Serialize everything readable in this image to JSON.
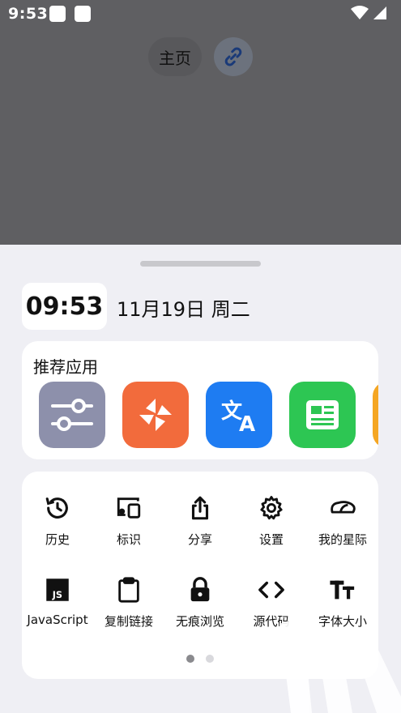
{
  "status_bar": {
    "time": "9:53"
  },
  "top": {
    "home_label": "主页",
    "link_icon": "link-icon"
  },
  "clock": {
    "time": "09:53",
    "date": "11月19日 周二"
  },
  "recommended": {
    "title": "推荐应用",
    "apps": [
      {
        "name": "sliders-app",
        "color": "#8d90ab"
      },
      {
        "name": "pinwheel-app",
        "color": "#f26b3c"
      },
      {
        "name": "translate-app",
        "color": "#1e7cf2"
      },
      {
        "name": "news-app",
        "color": "#2dc653"
      },
      {
        "name": "partial-app",
        "color": "#f5a623"
      }
    ]
  },
  "tools": {
    "row1": [
      "历史",
      "标识",
      "分享",
      "设置",
      "我的星际"
    ],
    "row2": [
      "JavaScript",
      "复制链接",
      "无痕浏览",
      "源代码",
      "字体大小"
    ]
  },
  "pager": {
    "current": 1,
    "total": 2
  }
}
